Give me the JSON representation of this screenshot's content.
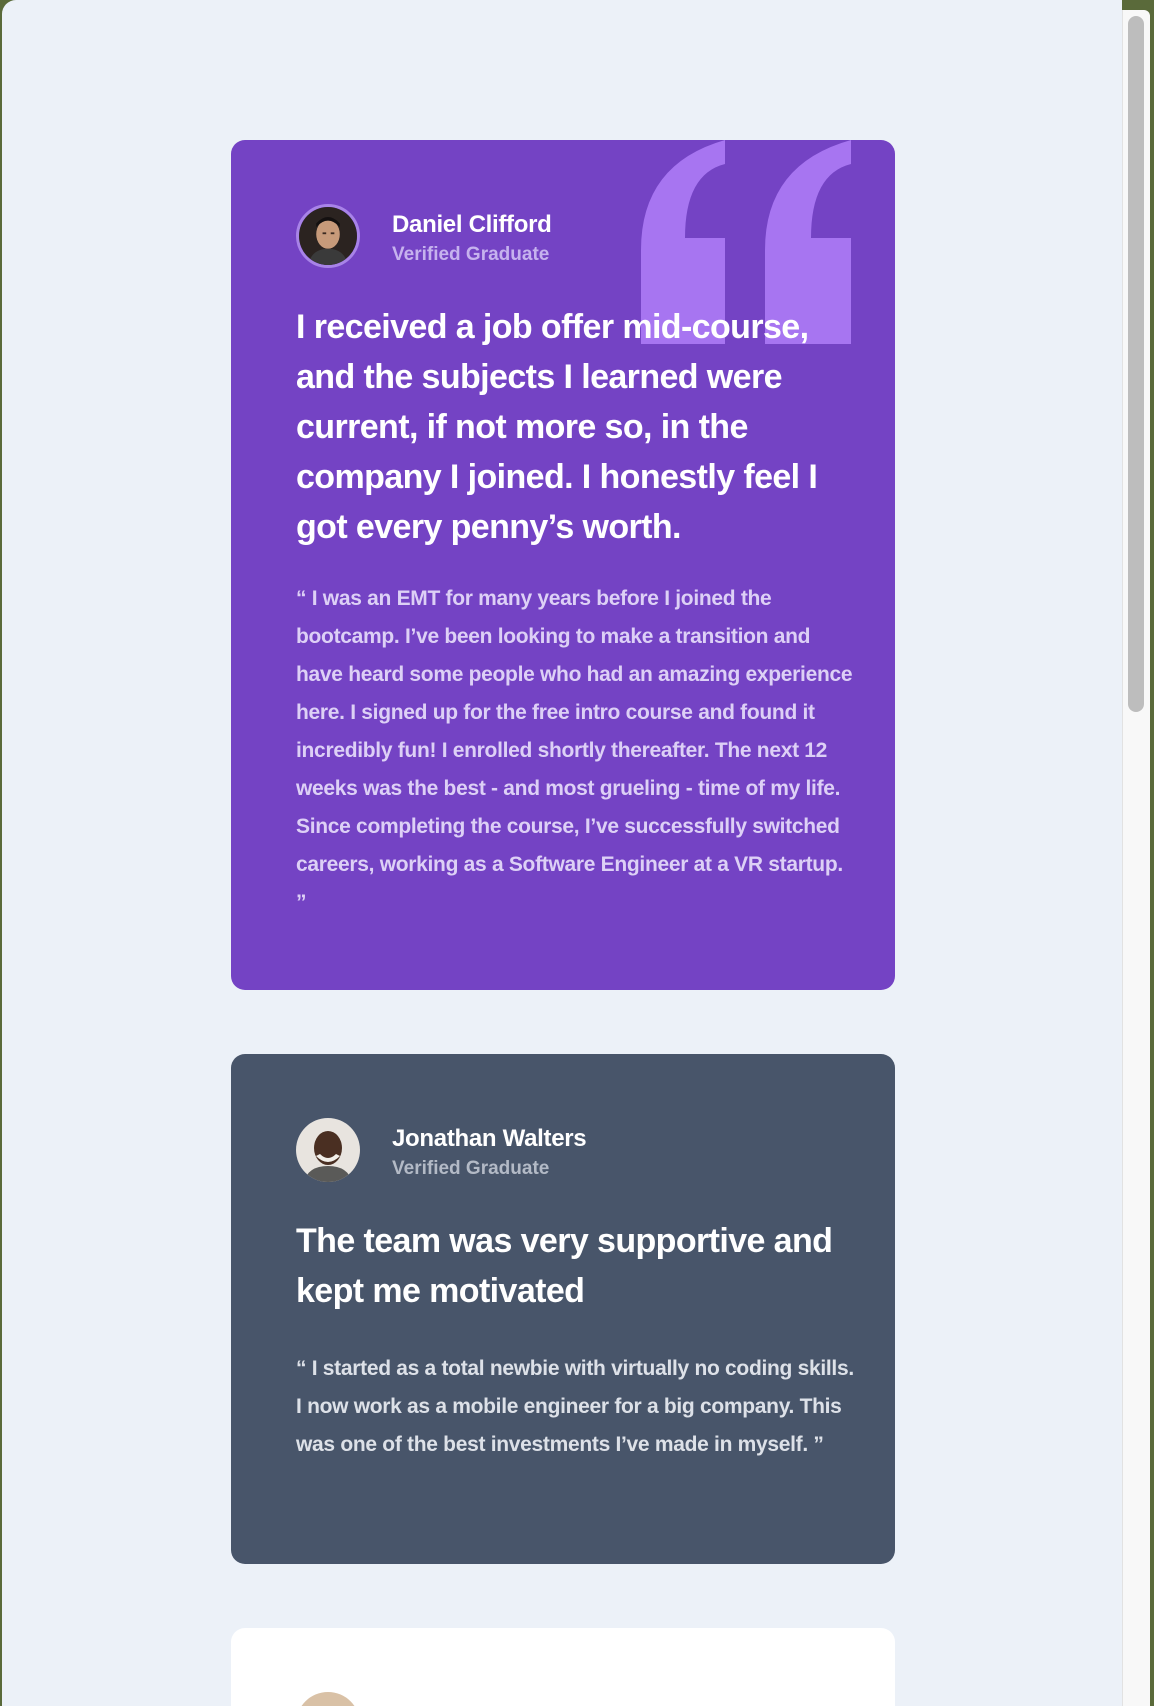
{
  "testimonials": [
    {
      "name": "Daniel Clifford",
      "role": "Verified Graduate",
      "headline": "I received a job offer mid-course, and the subjects I learned were current, if not more so, in the company I joined. I honestly feel I got every penny’s worth.",
      "body": "“ I was an EMT for many years before I joined the bootcamp. I’ve been looking to make a transition and have heard some people who had an amazing experience here. I signed up for the free intro course and found it incredibly fun! I enrolled shortly thereafter. The next 12 weeks was the best - and most grueling - time of my life. Since completing the course, I’ve successfully switched careers, working as a Software Engineer at a VR startup. ”",
      "avatar_icon": "avatar-daniel-icon",
      "background": "#7443c4",
      "quote_icon": "quotation-mark-icon",
      "quote_color": "#a775f1"
    },
    {
      "name": "Jonathan Walters",
      "role": "Verified Graduate",
      "headline": "The team was very supportive and kept me motivated",
      "body": "“ I started as a total newbie with virtually no coding skills. I now work as a mobile engineer for a big company. This was one of the best investments I’ve made in myself. ”",
      "avatar_icon": "avatar-jonathan-icon",
      "background": "#48556a"
    },
    {
      "avatar_icon": "avatar-jeanette-icon",
      "background": "#ffffff"
    }
  ]
}
